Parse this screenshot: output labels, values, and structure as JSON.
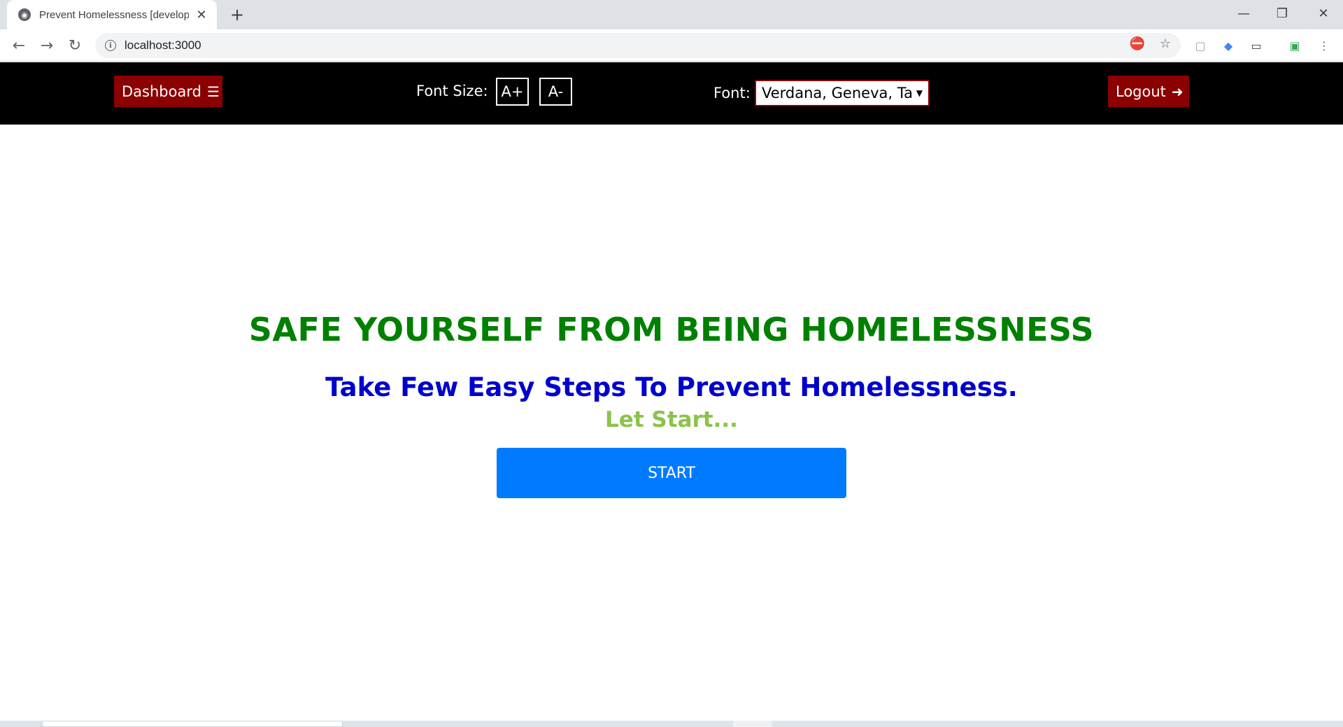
{
  "browser": {
    "tab_title": "Prevent Homelessness [developm",
    "tab_favicon": "globe-icon",
    "url": "localhost:3000",
    "new_tab_symbol": "+",
    "close_symbol": "✕"
  },
  "navbar": {
    "dashboard_label": "Dashboard",
    "font_size_label": "Font Size:",
    "increase_label": "A+",
    "decrease_label": "A-",
    "font_label": "Font:",
    "font_selected": "Verdana, Geneva, Tahoma",
    "logout_label": "Logout",
    "background_color": "#000000",
    "button_color": "#8b0000"
  },
  "main": {
    "title": "SAFE YOURSELF FROM BEING HOMELESSNESS",
    "subtitle": "Take Few Easy Steps To Prevent Homelessness.",
    "prompt": "Let Start...",
    "start_label": "START",
    "title_color": "#008000",
    "subtitle_color": "#0000cd",
    "prompt_color": "#8bc34a",
    "start_color": "#007bff"
  }
}
